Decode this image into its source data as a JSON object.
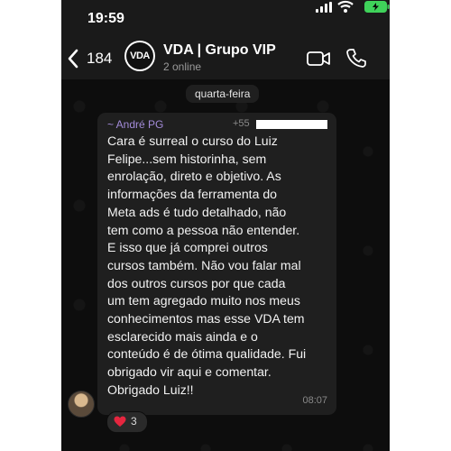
{
  "status_bar": {
    "time": "19:59"
  },
  "header": {
    "back_count": "184",
    "avatar_text": "VDA",
    "group_name": "VDA | Grupo VIP",
    "subtitle": "2 online"
  },
  "chat": {
    "date_label": "quarta-feira",
    "message": {
      "sender": "~ André PG",
      "phone_prefix": "+55",
      "lines": [
        "Cara é surreal o curso do Luiz",
        "Felipe...sem historinha, sem",
        "enrolação, direto e objetivo. As",
        "informações da ferramenta do",
        "Meta ads é tudo detalhado, não",
        "tem como a pessoa não entender.",
        "E isso que já comprei outros",
        "cursos também. Não vou falar mal",
        "dos outros cursos por que cada",
        "um tem agregado muito nos meus",
        "conhecimentos mas esse VDA tem",
        "esclarecido mais ainda e o",
        "conteúdo é de ótima qualidade. Fui",
        "obrigado vir aqui e comentar.",
        "Obrigado Luiz!!"
      ],
      "time": "08:07",
      "reaction_count": "3"
    }
  },
  "icons": [
    "back-icon",
    "video-call-icon",
    "phone-call-icon",
    "heart-icon",
    "signal-icon",
    "wifi-icon",
    "battery-icon"
  ],
  "colors": {
    "sender": "#a38bd9",
    "battery": "#3fd25a",
    "bubble": "#1f1f1f"
  }
}
